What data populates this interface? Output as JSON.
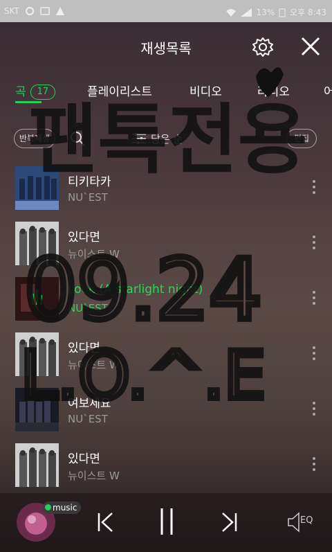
{
  "status_bar": {
    "carrier": "SKT",
    "battery": "13%",
    "time": "오후 8:43"
  },
  "header": {
    "title": "재생목록"
  },
  "tabs": [
    {
      "label": "곡",
      "badge": "17",
      "active": true
    },
    {
      "label": "플레이리스트"
    },
    {
      "label": "비디오"
    },
    {
      "label": "라디오"
    },
    {
      "label": "어"
    }
  ],
  "toolbar": {
    "repeat_label": "반복재생",
    "sort_label": "담은 순",
    "edit_label": "편집"
  },
  "songs": [
    {
      "title": "티키타카",
      "artist": "NU`EST"
    },
    {
      "title": "있다면",
      "artist": "뉴이스트 W"
    },
    {
      "title": "Look (A starlight night)",
      "artist": "NU`EST",
      "playing": true
    },
    {
      "title": "있다면",
      "artist": "뉴이스트 W"
    },
    {
      "title": "여보세요",
      "artist": "NU`EST"
    },
    {
      "title": "있다면",
      "artist": "뉴이스트 W"
    }
  ],
  "player": {
    "chip_label": "music",
    "eq_label": "EQ"
  },
  "overlay_text": {
    "line1": "팬톡전용",
    "line2": "09.24",
    "line3": "L.O.^.E"
  },
  "colors": {
    "accent": "#23d05a",
    "playing": "#2fd45a"
  }
}
